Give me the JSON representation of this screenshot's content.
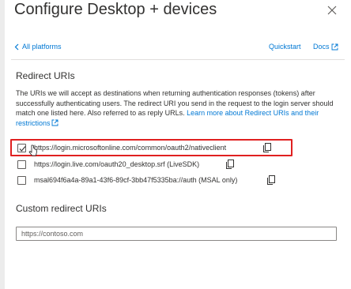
{
  "header": {
    "title": "Configure Desktop + devices",
    "close_icon": "close-icon"
  },
  "nav": {
    "back_label": "All platforms",
    "quickstart_label": "Quickstart",
    "docs_label": "Docs"
  },
  "redirect": {
    "title": "Redirect URIs",
    "description": "The URIs we will accept as destinations when returning authentication responses (tokens) after successfully authenticating users. The redirect URI you send in the request to the login server should match one listed here. Also referred to as reply URLs. ",
    "learn_more_label": "Learn more about Redirect URIs and their restrictions",
    "uris": [
      {
        "uri": "https://login.microsoftonline.com/common/oauth2/nativeclient",
        "checked": true
      },
      {
        "uri": "https://login.live.com/oauth20_desktop.srf (LiveSDK)",
        "checked": false
      },
      {
        "uri": "msal694f6a4a-89a1-43f6-89cf-3bb47f5335ba://auth (MSAL only)",
        "checked": false
      }
    ]
  },
  "custom": {
    "title": "Custom redirect URIs",
    "placeholder": "https://contoso.com",
    "value": ""
  },
  "colors": {
    "accent": "#0078d4",
    "highlight": "#e02020",
    "text": "#323130"
  }
}
